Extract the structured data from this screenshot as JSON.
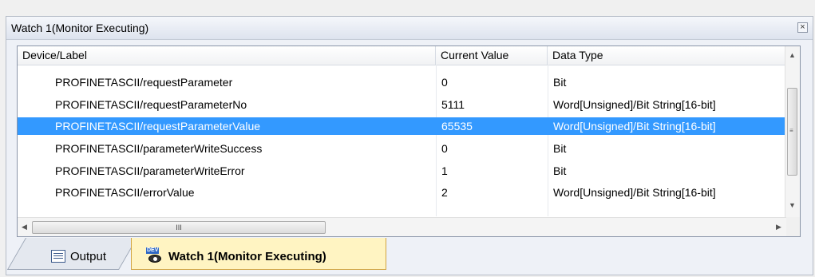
{
  "panel": {
    "title": "Watch 1(Monitor Executing)",
    "close_glyph": "×"
  },
  "columns": [
    "Device/Label",
    "Current Value",
    "Data Type"
  ],
  "rows": [
    {
      "label": "PROFINETASCII/requestParameter",
      "value": "0",
      "type": "Bit",
      "selected": false
    },
    {
      "label": "PROFINETASCII/requestParameterNo",
      "value": "5111",
      "type": "Word[Unsigned]/Bit String[16-bit]",
      "selected": false
    },
    {
      "label": "PROFINETASCII/requestParameterValue",
      "value": "65535",
      "type": "Word[Unsigned]/Bit String[16-bit]",
      "selected": true
    },
    {
      "label": "PROFINETASCII/parameterWriteSuccess",
      "value": "0",
      "type": "Bit",
      "selected": false
    },
    {
      "label": "PROFINETASCII/parameterWriteError",
      "value": "1",
      "type": "Bit",
      "selected": false
    },
    {
      "label": "PROFINETASCII/errorValue",
      "value": "2",
      "type": "Word[Unsigned]/Bit String[16-bit]",
      "selected": false
    }
  ],
  "scroll": {
    "thumb_grip": "III"
  },
  "tabs": {
    "output": "Output",
    "watch": "Watch 1(Monitor Executing)",
    "watch_icon_badge": "DEV"
  },
  "colors": {
    "selection": "#3399ff",
    "active_tab": "#fff4c2"
  }
}
